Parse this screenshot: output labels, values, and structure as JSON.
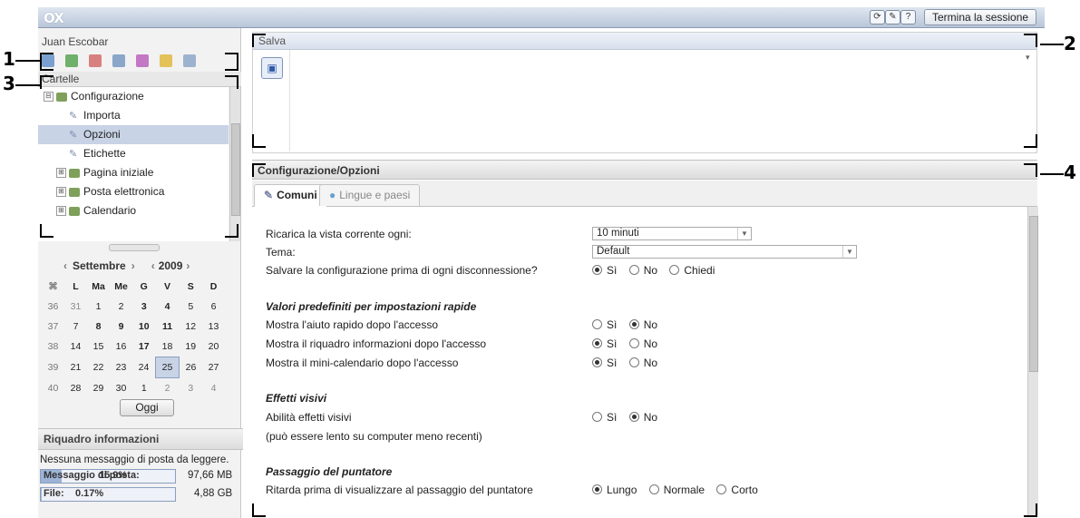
{
  "topbar": {
    "logo": "OX",
    "icons": [
      "refresh-icon",
      "wrench-icon",
      "help-icon"
    ],
    "icon_glyphs": [
      "⟳",
      "✎",
      "?"
    ],
    "logout_label": "Termina la sessione"
  },
  "sidebar": {
    "user_name": "Juan Escobar",
    "app_icons": [
      "home-icon",
      "mail-icon",
      "calendar-icon",
      "contacts-icon",
      "tasks-icon",
      "infostore-icon",
      "options-icon"
    ],
    "folders_header": "Cartelle",
    "tree": [
      {
        "label": "Configurazione",
        "expander": "⊟",
        "type": "folder"
      },
      {
        "label": "Importa",
        "type": "tool"
      },
      {
        "label": "Opzioni",
        "type": "tool",
        "selected": true
      },
      {
        "label": "Etichette",
        "type": "tool"
      },
      {
        "label": "Pagina iniziale",
        "expander": "⊞",
        "type": "folder"
      },
      {
        "label": "Posta elettronica",
        "expander": "⊞",
        "type": "folder"
      },
      {
        "label": "Calendario",
        "expander": "⊞",
        "type": "folder"
      }
    ]
  },
  "calendar": {
    "month": "Settembre",
    "year": "2009",
    "prev": "‹",
    "next": "›",
    "week_icon": "⌘",
    "weekdays": [
      "L",
      "Ma",
      "Me",
      "G",
      "V",
      "S",
      "D"
    ],
    "weeks": [
      {
        "wk": "36",
        "days": [
          "31",
          "1",
          "2",
          "3",
          "4",
          "5",
          "6"
        ]
      },
      {
        "wk": "37",
        "days": [
          "7",
          "8",
          "9",
          "10",
          "11",
          "12",
          "13"
        ]
      },
      {
        "wk": "38",
        "days": [
          "14",
          "15",
          "16",
          "17",
          "18",
          "19",
          "20"
        ]
      },
      {
        "wk": "39",
        "days": [
          "21",
          "22",
          "23",
          "24",
          "25",
          "26",
          "27"
        ]
      },
      {
        "wk": "40",
        "days": [
          "28",
          "29",
          "30",
          "1",
          "2",
          "3",
          "4"
        ]
      }
    ],
    "today_label": "Oggi"
  },
  "info_panel": {
    "title": "Riquadro informazioni",
    "message": "Nessuna messaggio di posta da leggere.",
    "quotas": [
      {
        "label": "Messaggio di posta:",
        "percent": "15.9%",
        "size": "97,66 MB"
      },
      {
        "label": "File:",
        "percent": "0.17%",
        "size": "4,88 GB"
      }
    ]
  },
  "toolbar": {
    "header": "Salva",
    "save_icon": "floppy-disk-icon",
    "save_glyph": "▣"
  },
  "config": {
    "breadcrumb": "Configurazione/Opzioni",
    "tabs": [
      "Comuni",
      "Lingue e paesi"
    ],
    "rows": [
      {
        "label": "Ricarica la vista corrente ogni:",
        "kind": "select",
        "value": "10 minuti"
      },
      {
        "label": "Tema:",
        "kind": "select",
        "value": "Default"
      },
      {
        "label": "Salvare la configurazione prima di ogni disconnessione?",
        "kind": "radio",
        "options": [
          "Sì",
          "No",
          "Chiedi"
        ],
        "selected": "Sì"
      }
    ],
    "sections": [
      {
        "title": "Valori predefiniti per impostazioni rapide",
        "rows": [
          {
            "label": "Mostra l'aiuto rapido dopo l'accesso",
            "options": [
              "Sì",
              "No"
            ],
            "selected": "No"
          },
          {
            "label": "Mostra il riquadro informazioni dopo l'accesso",
            "options": [
              "Sì",
              "No"
            ],
            "selected": "Sì"
          },
          {
            "label": "Mostra il mini-calendario dopo l'accesso",
            "options": [
              "Sì",
              "No"
            ],
            "selected": "Sì"
          }
        ]
      },
      {
        "title": "Effetti visivi",
        "rows": [
          {
            "label": "Abilità effetti visivi",
            "options": [
              "Sì",
              "No"
            ],
            "selected": "No"
          }
        ],
        "note": "(può essere lento su computer meno recenti)"
      },
      {
        "title": "Passaggio del puntatore",
        "rows": [
          {
            "label": "Ritarda prima di visualizzare al passaggio del puntatore",
            "options": [
              "Lungo",
              "Normale",
              "Corto"
            ],
            "selected": "Lungo"
          }
        ]
      }
    ]
  },
  "callouts": [
    "1",
    "2",
    "3",
    "4"
  ]
}
